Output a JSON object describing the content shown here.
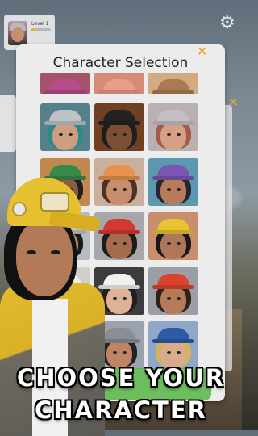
{
  "player": {
    "level_label": "Level 1",
    "level_progress": 0.2
  },
  "modal": {
    "title": "Character Selection"
  },
  "icons": {
    "settings": "gear-icon",
    "close": "close-icon"
  },
  "promo_lines": [
    "CHOOSE YOUR",
    "CHARACTER"
  ],
  "characters": [
    {
      "cap": "#b74c8b",
      "bg": "#a6526a",
      "face": "#d29676",
      "hair": "#43323a"
    },
    {
      "cap": "#e89d8a",
      "bg": "#d68a77",
      "face": "#c8845f",
      "hair": "#6a3d2d"
    },
    {
      "cap": "#aa7b53",
      "bg": "#d3aa83",
      "face": "#e1b08f",
      "hair": "#d7bc78"
    },
    {
      "cap": "#bfc3c8",
      "bg": "#56808a",
      "face": "#cf9c80",
      "hair": "#2e8a8a"
    },
    {
      "cap": "#222222",
      "bg": "#704023",
      "face": "#7c4f35",
      "hair": "#1e1e1e"
    },
    {
      "cap": "#c5bfc4",
      "bg": "#b8b0b1",
      "face": "#d5a184",
      "hair": "#a45b4a"
    },
    {
      "cap": "#37894a",
      "bg": "#c4874e",
      "face": "#8a5c41",
      "hair": "#1f1f1f"
    },
    {
      "cap": "#e7914b",
      "bg": "#c8b09d",
      "face": "#c78d6c",
      "hair": "#4e3125"
    },
    {
      "cap": "#7a56b0",
      "bg": "#5c98b0",
      "face": "#b67c5c",
      "hair": "#2a2432"
    },
    {
      "cap": "#c7c2bf",
      "bg": "#b5bcc3",
      "face": "#c48a69",
      "hair": "#1a1a1a"
    },
    {
      "cap": "#d13a32",
      "bg": "#a7a7a9",
      "face": "#a56d4e",
      "hair": "#1c1c1c"
    },
    {
      "cap": "#e8c432",
      "bg": "#c98e6e",
      "face": "#b0765a",
      "hair": "#181818"
    },
    {
      "cap": "#f0eee8",
      "bg": "#d0cfcb",
      "face": "#d1a281",
      "hair": "#161616"
    },
    {
      "cap": "#f2f1ee",
      "bg": "#3b3b40",
      "face": "#ddb297",
      "hair": "#1f1f1f"
    },
    {
      "cap": "#d9442f",
      "bg": "#9b9ea6",
      "face": "#b57a58",
      "hair": "#302219"
    },
    {
      "cap": "#4a4d55",
      "bg": "#7f7f85",
      "face": "#b2714f",
      "hair": "#1c1c1c"
    },
    {
      "cap": "#8a8d94",
      "bg": "#9aa3ad",
      "face": "#c08465",
      "hair": "#232323"
    },
    {
      "cap": "#2f5aa6",
      "bg": "#8fa8c8",
      "face": "#d9ab8a",
      "hair": "#d6b35a"
    }
  ]
}
